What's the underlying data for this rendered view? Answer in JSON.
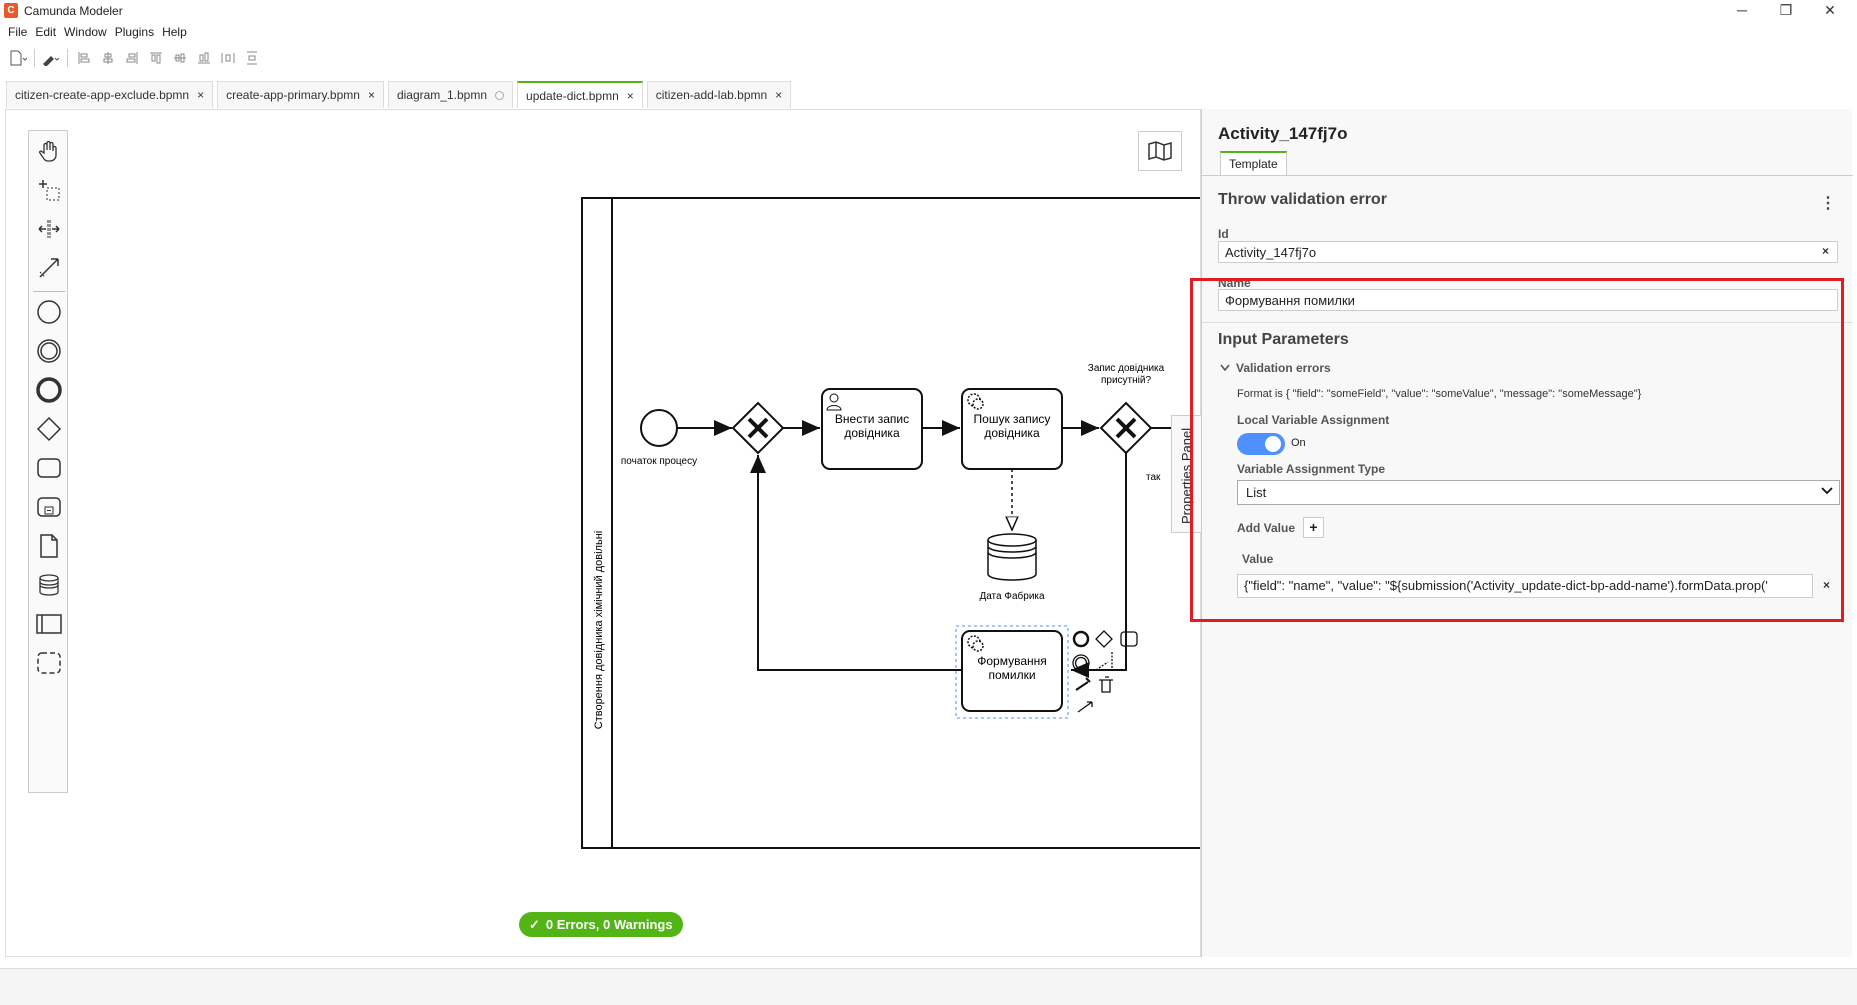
{
  "window": {
    "title": "Camunda Modeler",
    "minimize": "─",
    "maximize": "❐",
    "close": "✕"
  },
  "menu": [
    "File",
    "Edit",
    "Window",
    "Plugins",
    "Help"
  ],
  "tabs": [
    {
      "label": "citizen-create-app-exclude.bpmn",
      "close": "×"
    },
    {
      "label": "create-app-primary.bpmn",
      "close": "×"
    },
    {
      "label": "diagram_1.bpmn",
      "close": ""
    },
    {
      "label": "update-dict.bpmn",
      "close": "×",
      "active": true
    },
    {
      "label": "citizen-add-lab.bpmn",
      "close": "×"
    }
  ],
  "diagram": {
    "lane_label": "Створення довідника хімічний довільні",
    "start_event": "початок процесу",
    "task_user": "Внести запис довідника",
    "task_service": "Пошук запису довідника",
    "datastore": "Дата Фабрика",
    "gateway_question": "Запис довідника присутній?",
    "flow_yes": "так",
    "task_error": "Формування помилки",
    "properties_toggle": "Properties Panel"
  },
  "status": {
    "text": "0 Errors, 0 Warnings",
    "icon": "✓"
  },
  "properties": {
    "element_id_title": "Activity_147fj7o",
    "template_tab": "Template",
    "section_title": "Throw validation error",
    "kebab": "⋮",
    "id_label": "Id",
    "id_value": "Activity_147fj7o",
    "name_label": "Name",
    "name_value": "Формування помилки",
    "input_params_title": "Input Parameters",
    "validation_errors": "Validation errors",
    "format_hint": "Format is { \"field\": \"someField\", \"value\": \"someValue\", \"message\": \"someMessage\"}",
    "local_var_label": "Local Variable Assignment",
    "toggle_state": "On",
    "var_type_label": "Variable Assignment Type",
    "var_type_value": "List",
    "add_value_label": "Add Value",
    "add_value_btn": "+",
    "value_label": "Value",
    "value_text": "{\"field\": \"name\", \"value\": \"${submission('Activity_update-dict-bp-add-name').formData.prop('",
    "clear": "×"
  },
  "colors": {
    "accent_green": "#52b415",
    "highlight_red": "#e31b23",
    "toggle_blue": "#4d90fe"
  }
}
